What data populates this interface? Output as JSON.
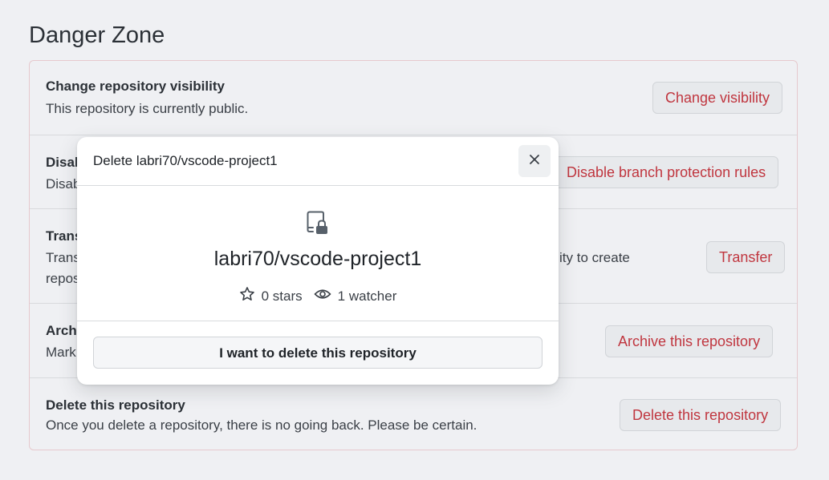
{
  "section": {
    "title": "Danger Zone"
  },
  "rows": [
    {
      "title": "Change repository visibility",
      "desc_lines": [
        "This repository is currently public."
      ],
      "button": "Change visibility"
    },
    {
      "title": "Disab",
      "desc_lines": [
        "Disab"
      ],
      "button": "Disable branch protection rules"
    },
    {
      "title": "Trans",
      "desc_lines": [
        "Trans                                                                                                                  bility to create",
        "repos"
      ],
      "desc_visible_right": "bility to create",
      "button": "Transfer"
    },
    {
      "title": "Archi",
      "desc_lines": [
        "Mark"
      ],
      "button": "Archive this repository"
    },
    {
      "title": "Delete this repository",
      "desc_lines": [
        "Once you delete a repository, there is no going back. Please be certain."
      ],
      "button": "Delete this repository"
    }
  ],
  "modal": {
    "title": "Delete labri70/vscode-project1",
    "repo_name": "labri70/vscode-project1",
    "stars": "0 stars",
    "watchers": "1 watcher",
    "confirm_button": "I want to delete this repository",
    "icons": {
      "close": "x-icon",
      "repo": "repo-locked-icon",
      "star": "star-icon",
      "watch": "eye-icon"
    }
  },
  "colors": {
    "danger_text": "#c0363f",
    "danger_border": "#e6c9cd",
    "background": "#eff0f3"
  }
}
